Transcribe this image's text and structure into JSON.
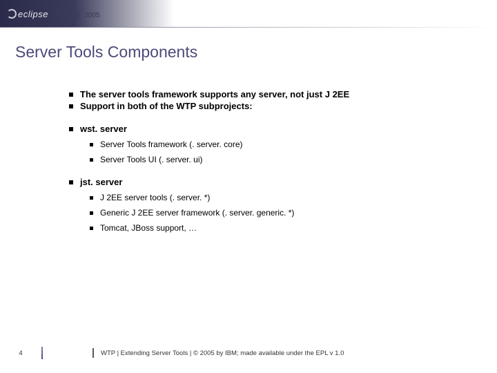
{
  "header": {
    "brand_part1": "eclipse",
    "brand_part2": "CON",
    "year": "2005"
  },
  "title": "Server Tools Components",
  "bullets_top": [
    "The server tools framework supports any server, not just J 2EE",
    "Support in both of the WTP subprojects:"
  ],
  "section_wst": {
    "heading": "wst. server",
    "items": [
      "Server Tools framework (. server. core)",
      "Server Tools UI (. server. ui)"
    ]
  },
  "section_jst": {
    "heading": "jst. server",
    "items": [
      "J 2EE server tools (. server. *)",
      "Generic J 2EE server framework (. server. generic. *)",
      "Tomcat, JBoss support, …"
    ]
  },
  "footer": {
    "page": "4",
    "text": "WTP  |  Extending Server Tools  |  © 2005 by IBM; made available under the EPL v 1.0"
  }
}
